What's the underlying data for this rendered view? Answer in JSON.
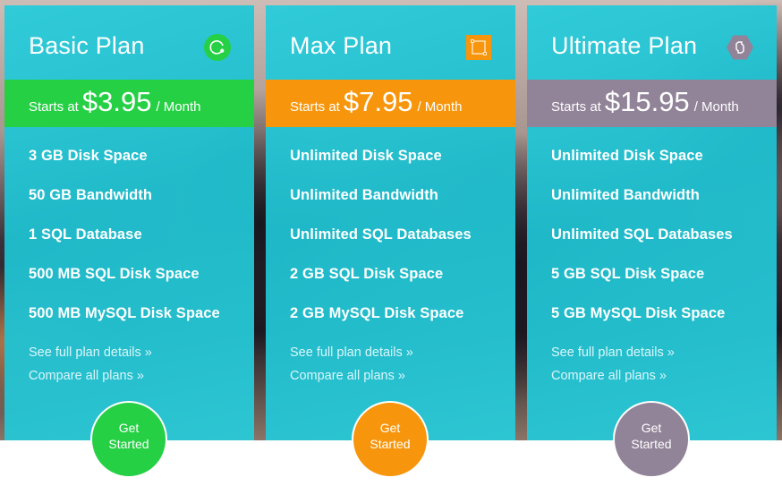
{
  "plans": [
    {
      "title": "Basic Plan",
      "icon": "refresh-circle-icon",
      "accent": "#26d045",
      "price": {
        "prefix": "Starts at",
        "amount": "$3.95",
        "period": "/ Month"
      },
      "features": [
        "3 GB Disk Space",
        "50 GB Bandwidth",
        "1 SQL Database",
        "500 MB SQL Disk Space",
        "500 MB MySQL Disk Space"
      ],
      "links": [
        "See full plan details »",
        "Compare all plans »"
      ],
      "cta": [
        "Get",
        "Started"
      ]
    },
    {
      "title": "Max Plan",
      "icon": "square-selection-icon",
      "accent": "#f7960d",
      "price": {
        "prefix": "Starts at",
        "amount": "$7.95",
        "period": "/ Month"
      },
      "features": [
        "Unlimited Disk Space",
        "Unlimited Bandwidth",
        "Unlimited SQL Databases",
        "2 GB SQL Disk Space",
        "2 GB MySQL Disk Space"
      ],
      "links": [
        "See full plan details »",
        "Compare all plans »"
      ],
      "cta": [
        "Get",
        "Started"
      ]
    },
    {
      "title": "Ultimate Plan",
      "icon": "sync-arrows-icon",
      "accent": "#918398",
      "price": {
        "prefix": "Starts at",
        "amount": "$15.95",
        "period": "/ Month"
      },
      "features": [
        "Unlimited Disk Space",
        "Unlimited Bandwidth",
        "Unlimited SQL Databases",
        "5 GB SQL Disk Space",
        "5 GB MySQL Disk Space"
      ],
      "links": [
        "See full plan details »",
        "Compare all plans »"
      ],
      "cta": [
        "Get",
        "Started"
      ]
    }
  ],
  "colors": {
    "card_bg": "#2bcad9",
    "text": "#ffffff",
    "link": "#d9f6fa"
  }
}
